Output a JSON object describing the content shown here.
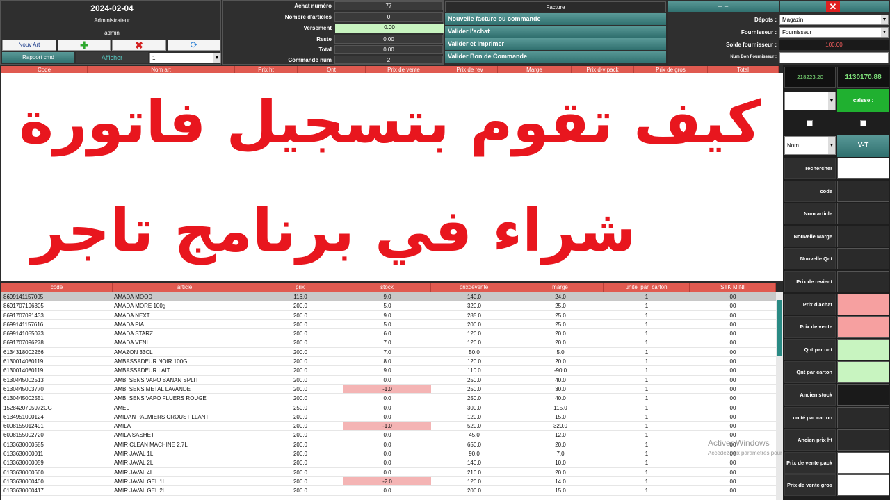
{
  "header": {
    "date": "2024-02-04",
    "user_role": "Administrateur",
    "user_name": "admin",
    "btn_nouv_art": "Nouv Art",
    "btn_rapport": "Rapport cmd",
    "btn_afficher": "Afficher",
    "select_value": "1"
  },
  "summary": {
    "achat_numero_label": "Achat numéro",
    "achat_numero": "77",
    "nombre_articles_label": "Nombre d'articles",
    "nombre_articles": "0",
    "versement_label": "Versement",
    "versement": "0.00",
    "reste_label": "Reste",
    "reste": "0.00",
    "total_label": "Total",
    "total": "0.00",
    "commande_num_label": "Commande num",
    "commande_num": "2"
  },
  "actions": {
    "facture": "Facture",
    "nouvelle": "Nouvelle facture ou commande",
    "valider_achat": "Valider l'achat",
    "valider_imprimer": "Valider et imprimer",
    "valider_bon": "Valider Bon de Commande"
  },
  "supplier": {
    "minus": "– –",
    "depots_label": "Dépots :",
    "depots_value": "Magazin",
    "fournisseur_label": "Fournisseur :",
    "fournisseur_value": "Fournisseur",
    "solde_label": "Solde fournisseur :",
    "solde_value": "100.00",
    "num_bon_label": "Num Bon Fournisseur :"
  },
  "invoice_columns": [
    "Code",
    "Nom art",
    "Prix ht",
    "Qnt",
    "Prix de vente",
    "Prix de rev",
    "Marge",
    "Prix d-v pack",
    "Prix de gros",
    "Total"
  ],
  "title_line1": "كيف تقوم بتسجيل فاتورة",
  "title_line2": "شراء في برنامج تاجر",
  "stock_columns": [
    "code",
    "article",
    "prix",
    "stock",
    "prixdevente",
    "marge",
    "unite_par_carton",
    "STK MINI"
  ],
  "stock_rows": [
    [
      "8699141157005",
      "AMADA MOOD",
      "116.0",
      "9.0",
      "140.0",
      "24.0",
      "1",
      "00"
    ],
    [
      "8691707196305",
      "AMADA MORE 100g",
      "200.0",
      "5.0",
      "320.0",
      "25.0",
      "1",
      "00"
    ],
    [
      "8691707091433",
      "AMADA NEXT",
      "200.0",
      "9.0",
      "285.0",
      "25.0",
      "1",
      "00"
    ],
    [
      "8699141157616",
      "AMADA PIA",
      "200.0",
      "5.0",
      "200.0",
      "25.0",
      "1",
      "00"
    ],
    [
      "8699141055073",
      "AMADA STARZ",
      "200.0",
      "6.0",
      "120.0",
      "20.0",
      "1",
      "00"
    ],
    [
      "8691707096278",
      "AMADA VENI",
      "200.0",
      "7.0",
      "120.0",
      "20.0",
      "1",
      "00"
    ],
    [
      "6134318002266",
      "AMAZON 33CL",
      "200.0",
      "7.0",
      "50.0",
      "5.0",
      "1",
      "00"
    ],
    [
      "6130014080119",
      "AMBASSADEUR  NOIR 100G",
      "200.0",
      "8.0",
      "120.0",
      "20.0",
      "1",
      "00"
    ],
    [
      "6130014080119",
      "AMBASSADEUR LAIT",
      "200.0",
      "9.0",
      "110.0",
      "-90.0",
      "1",
      "00"
    ],
    [
      "6130445002513",
      "AMBI SENS  VAPO BANAN SPLIT",
      "200.0",
      "0.0",
      "250.0",
      "40.0",
      "1",
      "00"
    ],
    [
      "6130445003770",
      "AMBI SENS METAL LAVANDE",
      "200.0",
      "-1.0",
      "250.0",
      "30.0",
      "1",
      "00"
    ],
    [
      "6130445002551",
      "AMBI SENS VAPO FLUERS ROUGE",
      "200.0",
      "0.0",
      "250.0",
      "40.0",
      "1",
      "00"
    ],
    [
      "1528420705972CG",
      "AMEL",
      "250.0",
      "0.0",
      "300.0",
      "115.0",
      "1",
      "00"
    ],
    [
      "6134951000124",
      "AMIDAN PALMIERS CROUSTILLANT",
      "200.0",
      "0.0",
      "120.0",
      "15.0",
      "1",
      "00"
    ],
    [
      "6008155012491",
      "AMILA",
      "200.0",
      "-1.0",
      "520.0",
      "320.0",
      "1",
      "00"
    ],
    [
      "6008155002720",
      "AMILA SASHET",
      "200.0",
      "0.0",
      "45.0",
      "12.0",
      "1",
      "00"
    ],
    [
      "6133630000585",
      "AMIR CLEAN MACHINE 2.7L",
      "200.0",
      "0.0",
      "650.0",
      "20.0",
      "1",
      "00"
    ],
    [
      "6133630000011",
      "AMIR JAVAL 1L",
      "200.0",
      "0.0",
      "90.0",
      "7.0",
      "1",
      "00"
    ],
    [
      "6133630000059",
      "AMIR JAVAL 2L",
      "200.0",
      "0.0",
      "140.0",
      "10.0",
      "1",
      "00"
    ],
    [
      "6133630000660",
      "AMIR JAVAL 4L",
      "200.0",
      "0.0",
      "210.0",
      "20.0",
      "1",
      "00"
    ],
    [
      "6133630000400",
      "AMIR JAVAL GEL 1L",
      "200.0",
      "-2.0",
      "120.0",
      "14.0",
      "1",
      "00"
    ],
    [
      "6133630000417",
      "AMIR JAVAL GEL 2L",
      "200.0",
      "0.0",
      "200.0",
      "15.0",
      "1",
      "00"
    ]
  ],
  "right": {
    "total1": "218223.20",
    "total2": "1130170.88",
    "caisse": "caisse :",
    "nom_select": "Nom",
    "vt": "V-T",
    "labels": [
      "rechercher",
      "code",
      "Nom article",
      "Nouvelle Marge",
      "Nouvelle Qnt",
      "Prix de revient",
      "Prix d'achat",
      "Prix de vente",
      "Qnt par unt",
      "Qnt par carton",
      "Ancien stock",
      "unité par carton",
      "Ancien prix ht",
      "Prix de vente pack",
      "Prix de vente gros"
    ]
  },
  "watermark": {
    "line1": "Activer Windows",
    "line2": "Accédez aux paramètres pour activer Windows."
  },
  "colors": {
    "accent_red": "#e05a50",
    "teal": "#2f6f6e",
    "pink": "#f6a0a0",
    "green": "#c8f4c0"
  }
}
